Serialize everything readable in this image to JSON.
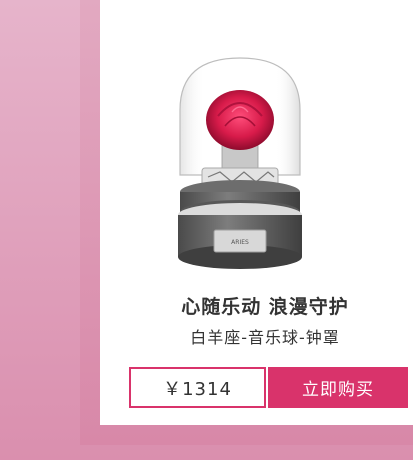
{
  "product": {
    "title": "心随乐动 浪漫守护",
    "subtitle": "白羊座-音乐球-钟罩",
    "price": "￥1314",
    "buy_label": "立即购买",
    "plate_text": "ARIES"
  },
  "colors": {
    "accent": "#d9336b",
    "frame": "#e2a9c1",
    "rose": "#d81b4a"
  },
  "icons": {
    "product_image": "rose-music-box-image"
  }
}
